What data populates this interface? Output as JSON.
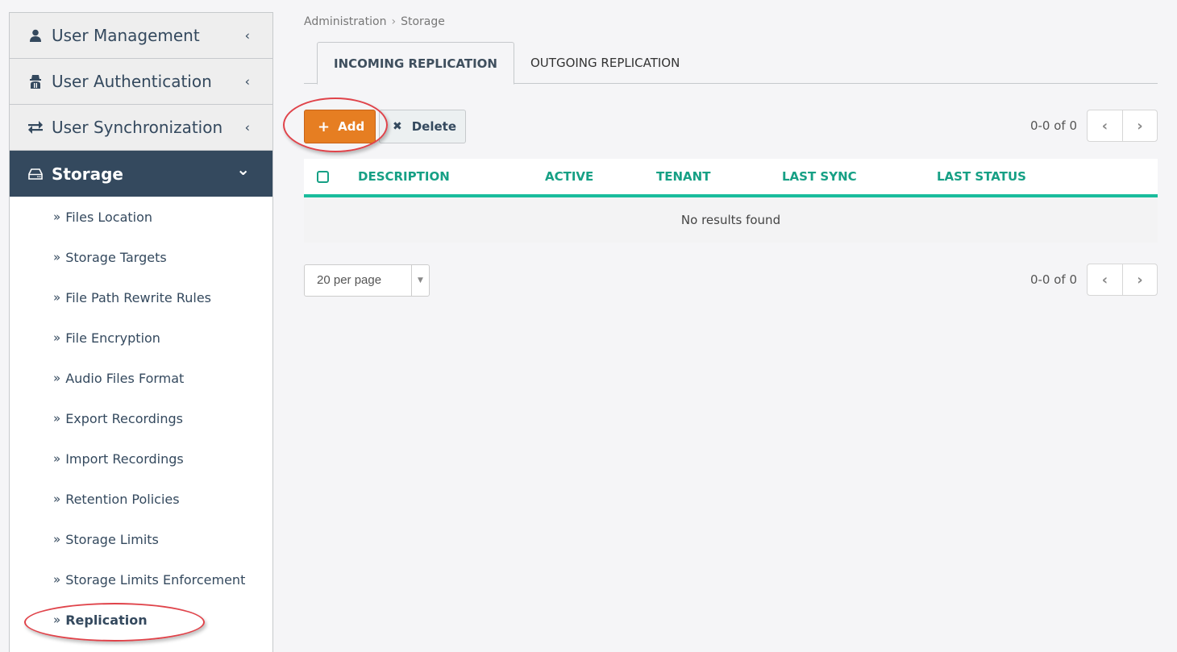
{
  "sidebar": {
    "groups": [
      {
        "label": "User Management",
        "icon": "user-icon",
        "chevron": "‹"
      },
      {
        "label": "User Authentication",
        "icon": "spy-icon",
        "chevron": "‹"
      },
      {
        "label": "User Synchronization",
        "icon": "exchange-icon",
        "chevron": "‹"
      },
      {
        "label": "Storage",
        "icon": "hdd-icon",
        "chevron": "⌄"
      }
    ],
    "sub_prefix": "»",
    "items": [
      {
        "label": "Files Location"
      },
      {
        "label": "Storage Targets"
      },
      {
        "label": "File Path Rewrite Rules"
      },
      {
        "label": "File Encryption"
      },
      {
        "label": "Audio Files Format"
      },
      {
        "label": "Export Recordings"
      },
      {
        "label": "Import Recordings"
      },
      {
        "label": "Retention Policies"
      },
      {
        "label": "Storage Limits"
      },
      {
        "label": "Storage Limits Enforcement"
      },
      {
        "label": "Replication"
      }
    ]
  },
  "breadcrumb": {
    "items": [
      "Administration",
      "Storage"
    ],
    "separator": "›"
  },
  "tabs": [
    {
      "label": "INCOMING REPLICATION"
    },
    {
      "label": "OUTGOING REPLICATION"
    }
  ],
  "toolbar": {
    "add_label": "Add",
    "add_icon": "+",
    "delete_label": "Delete",
    "delete_icon": "✖"
  },
  "pager": {
    "count_text": "0-0 of 0",
    "prev": "‹",
    "next": "›"
  },
  "table": {
    "columns": [
      "DESCRIPTION",
      "ACTIVE",
      "TENANT",
      "LAST SYNC",
      "LAST STATUS"
    ],
    "empty_text": "No results found"
  },
  "per_page": {
    "value": "20 per page",
    "arrow": "▼"
  },
  "colors": {
    "accent": "#1abc9c",
    "header_text": "#16a085",
    "add_button": "#e67e22",
    "nav_active": "#34495e",
    "annotation": "#e0434a"
  }
}
